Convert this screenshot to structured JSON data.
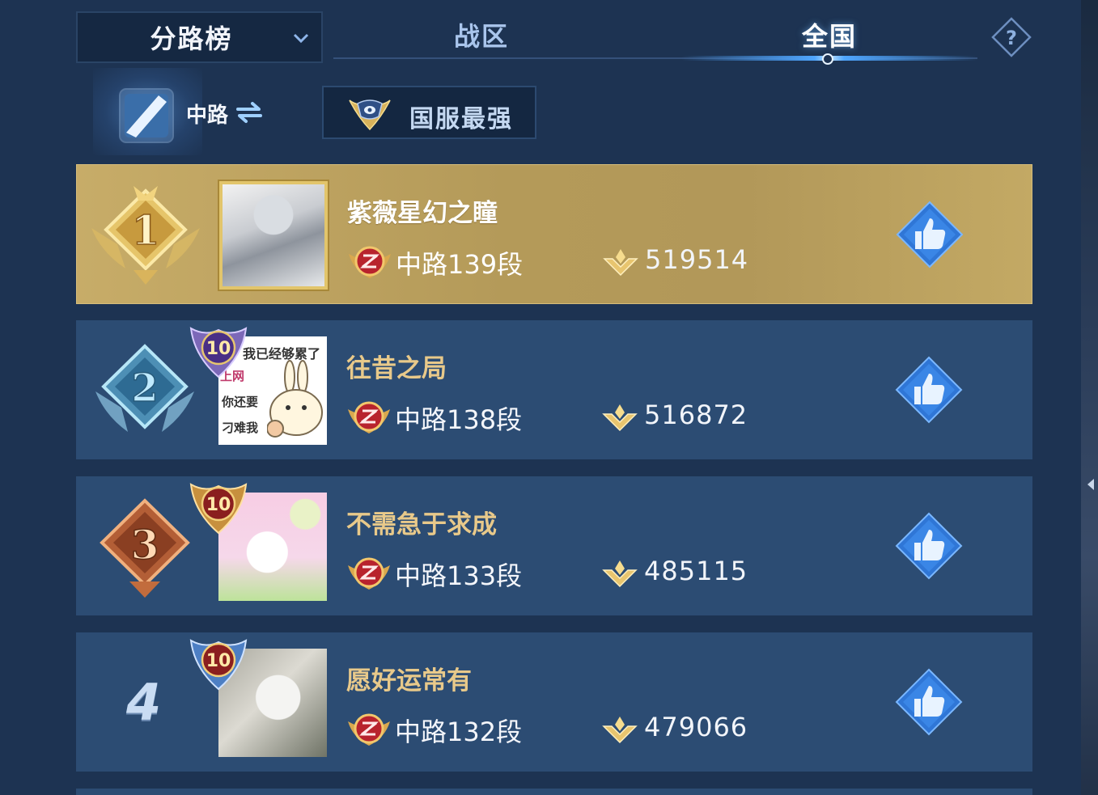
{
  "header": {
    "dropdown_label": "分路榜",
    "tabs": [
      {
        "label": "战区",
        "active": false
      },
      {
        "label": "全国",
        "active": true
      }
    ]
  },
  "filters": {
    "lane_label": "中路",
    "strongest_label": "国服最强"
  },
  "leaderboard": [
    {
      "rank": "1",
      "name": "紫薇星幻之瞳",
      "tier": "中路139段",
      "score": "519514"
    },
    {
      "rank": "2",
      "name": "往昔之局",
      "tier": "中路138段",
      "score": "516872",
      "level_badge": "10",
      "avatar_meme": {
        "top": "我已经够累了",
        "a": "上网",
        "b": "你还要",
        "c": "刁难我"
      }
    },
    {
      "rank": "3",
      "name": "不需急于求成",
      "tier": "中路133段",
      "score": "485115",
      "level_badge": "10"
    },
    {
      "rank": "4",
      "name": "愿好运常有",
      "tier": "中路132段",
      "score": "479066",
      "level_badge": "10"
    }
  ],
  "colors": {
    "background": "#1d3352",
    "row": "#2c4c73",
    "gold_row": "#b49a59",
    "name_gold": "#e8c98a",
    "accent_blue": "#4fa6ff"
  },
  "icons": [
    "chevron-down-icon",
    "help-icon",
    "lane-mid-icon",
    "swap-icon",
    "strongest-emblem-icon",
    "rank-badge-icon",
    "tier-badge-icon",
    "score-icon",
    "thumbs-up-icon"
  ]
}
